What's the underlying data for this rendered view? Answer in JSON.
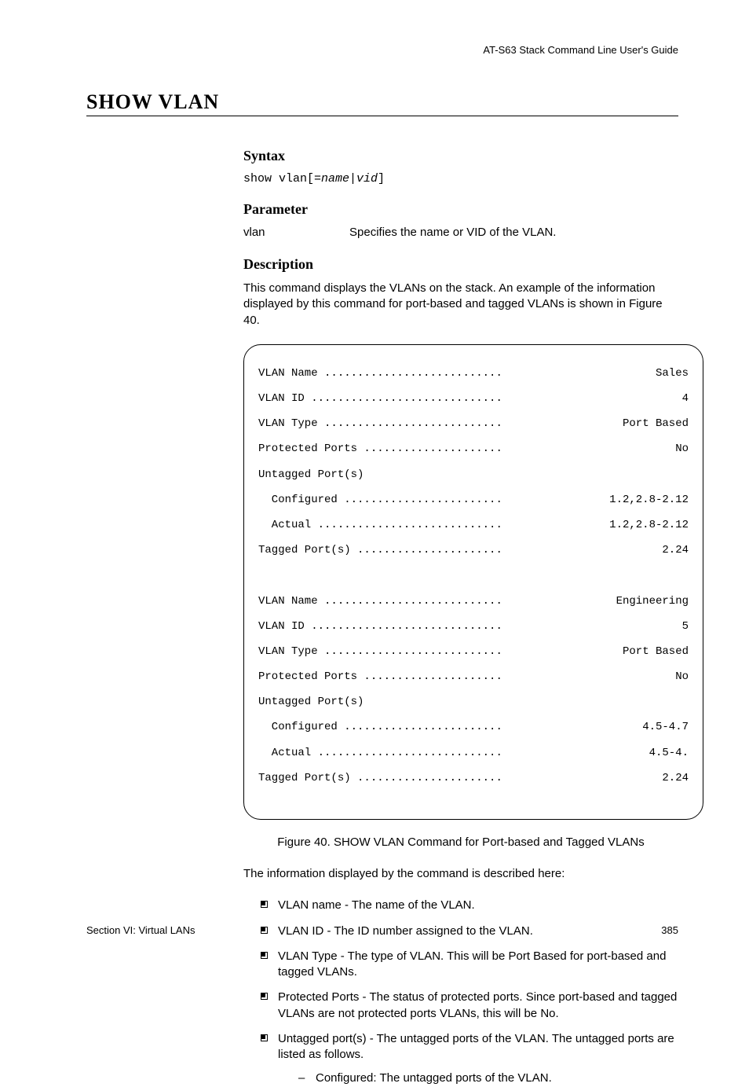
{
  "header": {
    "guide": "AT-S63 Stack Command Line User's Guide"
  },
  "title": "SHOW VLAN",
  "syntax": {
    "heading": "Syntax",
    "cmd_prefix": "show vlan[=",
    "cmd_italic": "name|vid",
    "cmd_suffix": "]"
  },
  "parameter": {
    "heading": "Parameter",
    "key": "vlan",
    "desc": "Specifies the name or VID of the VLAN."
  },
  "description": {
    "heading": "Description",
    "para": "This command displays the VLANs on the stack. An example of the information displayed by this command for port-based and tagged VLANs is shown in Figure 40."
  },
  "terminal": {
    "vlan1": {
      "name_k": "VLAN Name ",
      "name_v": "Sales",
      "id_k": "VLAN ID ",
      "id_v": "4",
      "type_k": "VLAN Type ",
      "type_v": "Port Based",
      "prot_k": "Protected Ports ",
      "prot_v": "No",
      "untag_hdr": "Untagged Port(s)",
      "conf_k": "  Configured ",
      "conf_v": "1.2,2.8-2.12",
      "act_k": "  Actual ",
      "act_v": "1.2,2.8-2.12",
      "tag_k": "Tagged Port(s) ",
      "tag_v": "2.24"
    },
    "vlan2": {
      "name_k": "VLAN Name ",
      "name_v": "Engineering",
      "id_k": "VLAN ID ",
      "id_v": "5",
      "type_k": "VLAN Type ",
      "type_v": "Port Based",
      "prot_k": "Protected Ports ",
      "prot_v": "No",
      "untag_hdr": "Untagged Port(s)",
      "conf_k": "  Configured ",
      "conf_v": "4.5-4.7",
      "act_k": "  Actual ",
      "act_v": "4.5-4.",
      "tag_k": "Tagged Port(s) ",
      "tag_v": "2.24"
    }
  },
  "caption": "Figure 40. SHOW VLAN Command for Port-based and Tagged VLANs",
  "post_para": "The information displayed by the command is described here:",
  "bullets": [
    "VLAN name - The name of the VLAN.",
    "VLAN ID - The ID number assigned to the VLAN.",
    "VLAN Type - The type of VLAN. This will be Port Based for port-based and tagged VLANs.",
    "Protected Ports - The status of protected ports. Since port-based and tagged VLANs are not protected ports VLANs, this will be No.",
    "Untagged port(s) - The untagged ports of the VLAN. The untagged ports are listed as follows."
  ],
  "subbullet": "Configured: The untagged ports of the VLAN.",
  "footer": {
    "left": "Section VI: Virtual LANs",
    "right": "385"
  }
}
